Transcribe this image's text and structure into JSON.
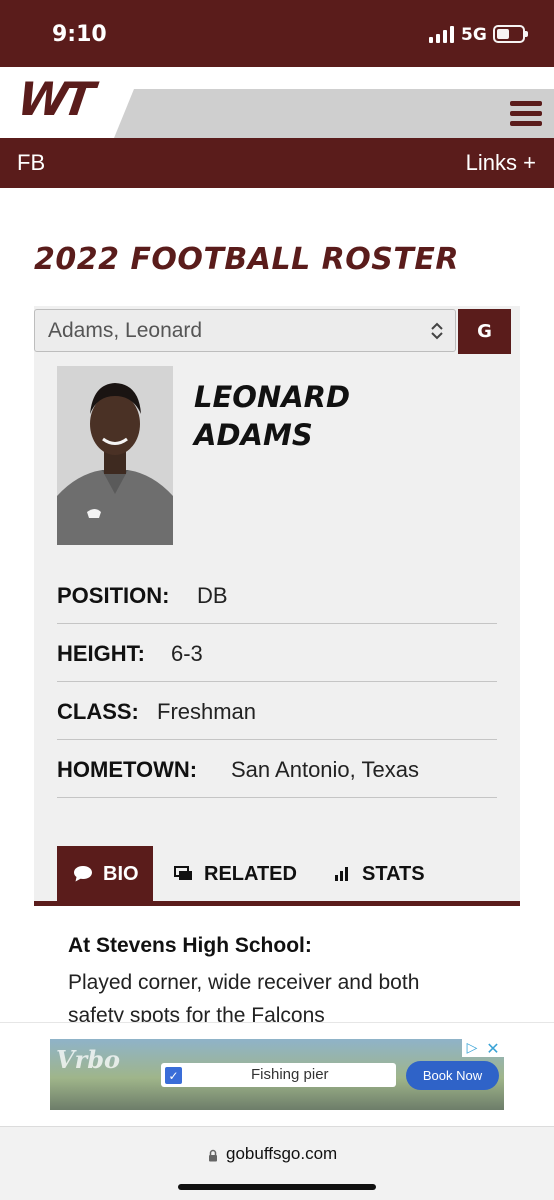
{
  "status_bar": {
    "time": "9:10",
    "network": "5G"
  },
  "header": {
    "logo_text": "WT"
  },
  "sport_bar": {
    "sport": "FB",
    "links_label": "Links +"
  },
  "page_title": "2022 FOOTBALL ROSTER",
  "roster": {
    "select_value": "Adams, Leonard",
    "go_label": "G",
    "player_name_line1": "LEONARD",
    "player_name_line2": "ADAMS",
    "info": [
      {
        "label": "POSITION:",
        "value": "DB"
      },
      {
        "label": "HEIGHT:",
        "value": "6-3"
      },
      {
        "label": "CLASS:",
        "value": "Freshman"
      },
      {
        "label": "HOMETOWN:",
        "value": "San Antonio, Texas"
      }
    ]
  },
  "tabs": [
    {
      "label": "BIO",
      "icon": "speech-bubble-icon",
      "active": true
    },
    {
      "label": "RELATED",
      "icon": "related-stack-icon",
      "active": false
    },
    {
      "label": "STATS",
      "icon": "bar-chart-icon",
      "active": false
    }
  ],
  "bio": {
    "heading": "At Stevens High School:",
    "text": "Played corner, wide receiver and both safety spots for the Falcons"
  },
  "ad": {
    "brand": "Vrbo",
    "search_text": "Fishing pier",
    "cta": "Book Now"
  },
  "url_bar": {
    "url": "gobuffsgo.com"
  },
  "colors": {
    "maroon": "#5a1c1b",
    "card_bg": "#f0f0f0"
  }
}
